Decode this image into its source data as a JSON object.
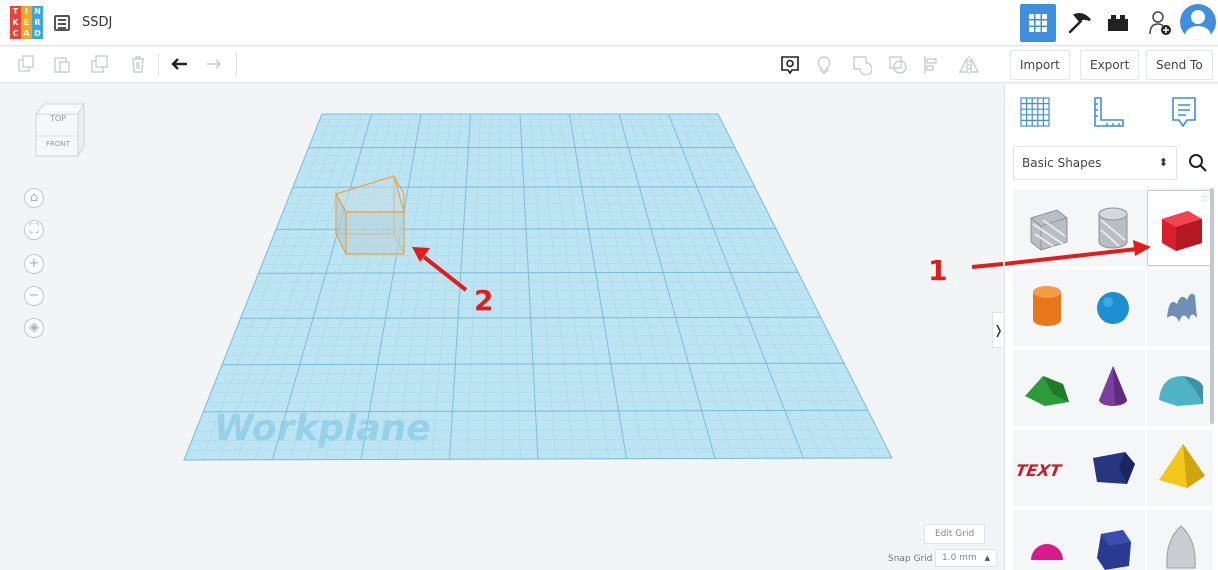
{
  "app": {
    "logo_letters": [
      "T",
      "I",
      "N",
      "K",
      "E",
      "R",
      "C",
      "A",
      "D"
    ],
    "logo_colors": [
      "#e8423a",
      "#f5a623",
      "#3aa7e0",
      "#e8423a",
      "#f5a623",
      "#3aa7e0",
      "#e8423a",
      "#f5a623",
      "#3aa7e0"
    ],
    "design_title": "SSDJ",
    "accent_color": "#3f8ee0"
  },
  "topbar": {
    "view_icons": [
      "3d-design-view-icon",
      "circuits-view-icon",
      "blocks-view-icon",
      "add-user-icon",
      "profile-avatar-icon"
    ]
  },
  "toolbar": {
    "edit_icons": [
      "copy-icon",
      "paste-icon",
      "duplicate-icon",
      "delete-icon",
      "undo-icon",
      "redo-icon"
    ],
    "shape_icons": [
      "notes-icon",
      "light-bulb-icon",
      "group-icon",
      "ungroup-icon",
      "align-icon",
      "mirror-icon"
    ],
    "import_label": "Import",
    "export_label": "Export",
    "send_to_label": "Send To"
  },
  "viewcube": {
    "top_label": "TOP",
    "front_label": "FRONT"
  },
  "nav_controls": [
    "home-view-icon",
    "fit-view-icon",
    "zoom-in-icon",
    "zoom-out-icon",
    "perspective-icon"
  ],
  "workplane": {
    "label": "Workplane"
  },
  "grid_controls": {
    "edit_grid_label": "Edit Grid",
    "snap_grid_label": "Snap Grid",
    "snap_grid_value": "1.0 mm"
  },
  "annotations": {
    "marker_1": "1",
    "marker_2": "2",
    "arrow_color": "#e31b1b"
  },
  "panel": {
    "tabs": [
      "workplane-tab-icon",
      "ruler-tab-icon",
      "notes-tab-icon"
    ],
    "category_value": "Basic Shapes",
    "shapes": [
      {
        "name": "box-hole",
        "color": "#b9bec4"
      },
      {
        "name": "cylinder-hole",
        "color": "#b9bec4"
      },
      {
        "name": "box",
        "color": "#d9212c"
      },
      {
        "name": "cylinder",
        "color": "#e8761a"
      },
      {
        "name": "sphere",
        "color": "#1d8fd0"
      },
      {
        "name": "scribble",
        "color": "#6f8fb7"
      },
      {
        "name": "roof",
        "color": "#2e9b3a"
      },
      {
        "name": "cone",
        "color": "#7b3fa0"
      },
      {
        "name": "round-roof",
        "color": "#4fb3c8"
      },
      {
        "name": "text",
        "color": "#c81e2a"
      },
      {
        "name": "wedge",
        "color": "#26377f"
      },
      {
        "name": "pyramid",
        "color": "#f2c81b"
      },
      {
        "name": "half-sphere",
        "color": "#d81b8a"
      },
      {
        "name": "polygon",
        "color": "#2a3a90"
      },
      {
        "name": "paraboloid",
        "color": "#c9ccd0"
      }
    ]
  }
}
